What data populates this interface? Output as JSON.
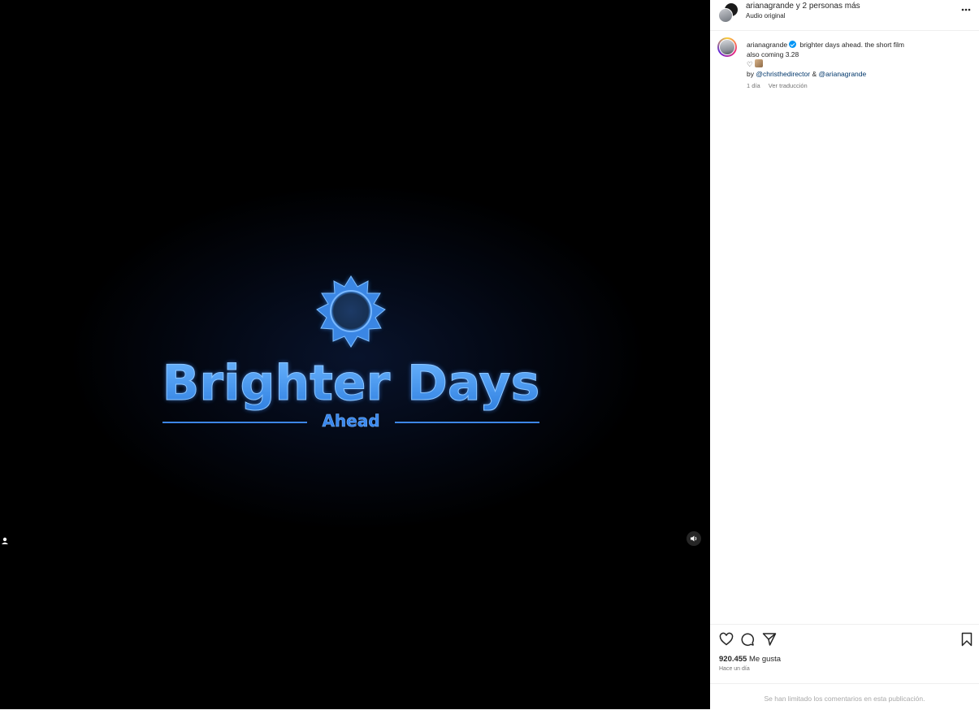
{
  "video": {
    "title_main": "Brighter Days",
    "title_sub": "Ahead",
    "colors": {
      "glow": "#3b8bff",
      "text": "#4aa0ff"
    },
    "user_tag_icon": "person-icon",
    "mute_icon": "speaker-icon"
  },
  "header": {
    "user": "arianagrande",
    "collab_suffix": "y 2 personas más",
    "audio": "Audio original",
    "more_icon": "more-horizontal-icon"
  },
  "caption": {
    "user": "arianagrande",
    "text_line1": "brighter days ahead. the short film",
    "text_line2": "also coming 3.28",
    "heart": "♡",
    "by_prefix": "by",
    "mention1": "@christhedirector",
    "amp": "&",
    "mention2": "@arianagrande",
    "time": "1 día",
    "translate": "Ver traducción"
  },
  "actions": {
    "icons": [
      "heart-icon",
      "comment-icon",
      "share-icon",
      "bookmark-icon"
    ],
    "likes_count": "920.455",
    "likes_label": "Me gusta",
    "posted": "Hace un día"
  },
  "footer": {
    "comments_limited": "Se han limitado los comentarios en esta publicación."
  }
}
